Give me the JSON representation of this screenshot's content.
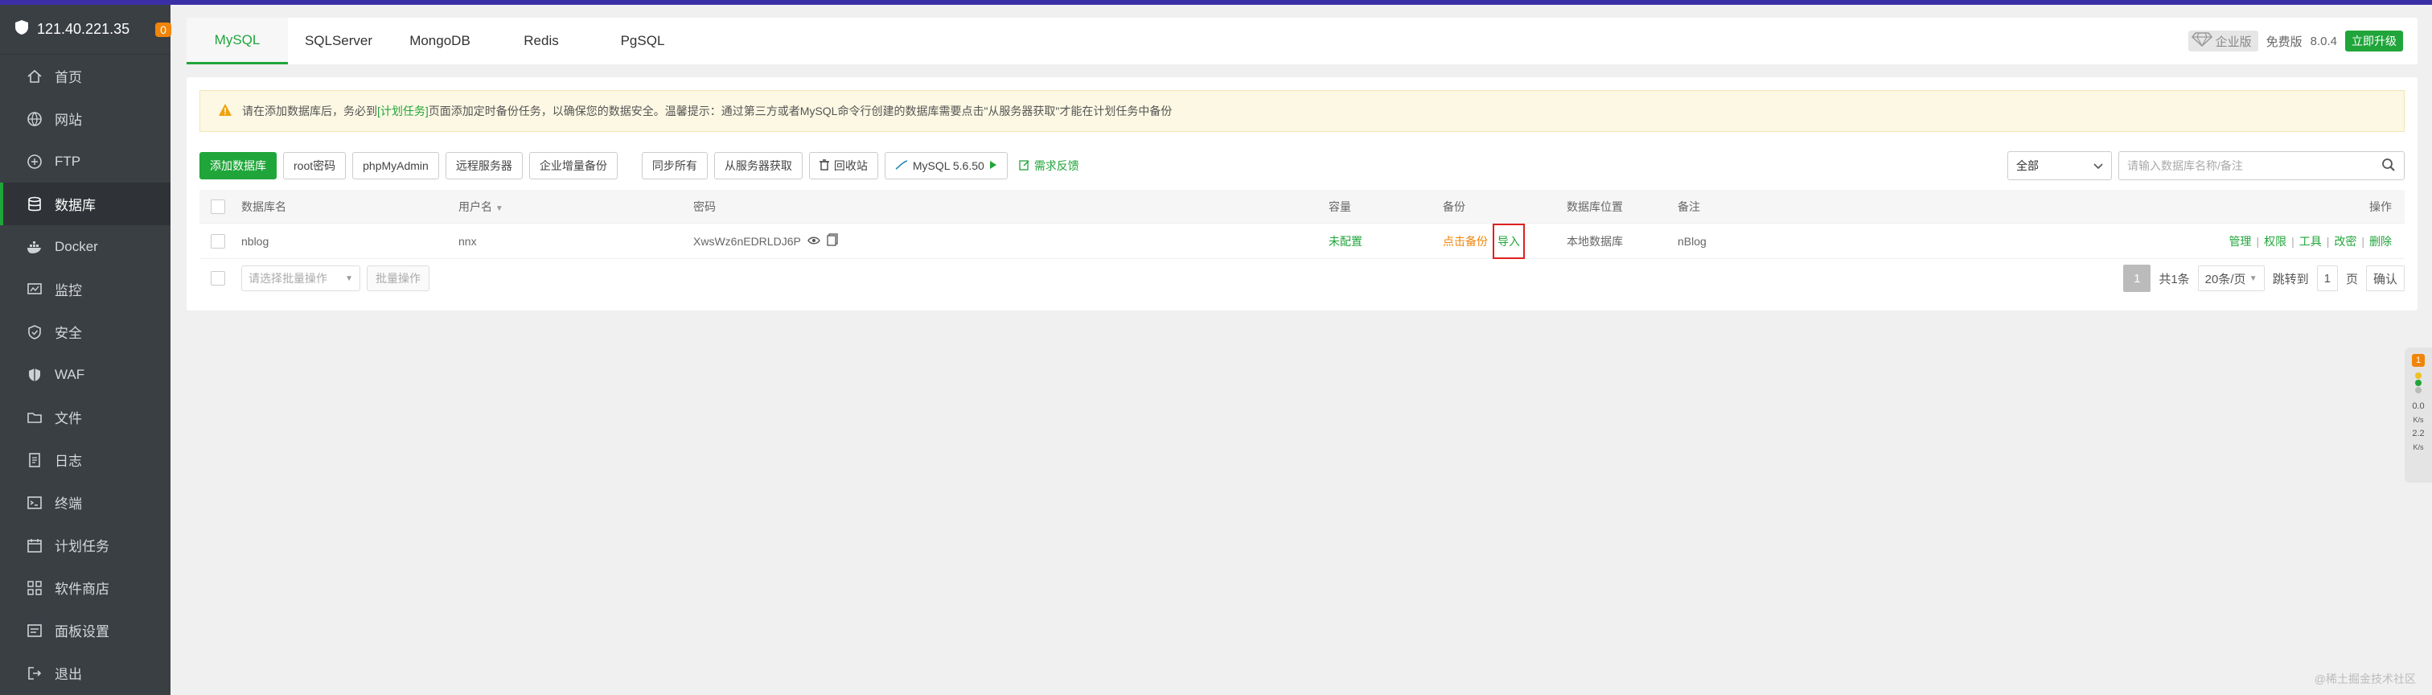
{
  "sidebar": {
    "ip": "121.40.221.35",
    "badge": "0",
    "items": [
      {
        "label": "首页",
        "icon": "home-icon"
      },
      {
        "label": "网站",
        "icon": "globe-icon"
      },
      {
        "label": "FTP",
        "icon": "ftp-icon"
      },
      {
        "label": "数据库",
        "icon": "database-icon"
      },
      {
        "label": "Docker",
        "icon": "docker-icon"
      },
      {
        "label": "监控",
        "icon": "monitor-icon"
      },
      {
        "label": "安全",
        "icon": "shield-icon"
      },
      {
        "label": "WAF",
        "icon": "waf-icon"
      },
      {
        "label": "文件",
        "icon": "folder-icon"
      },
      {
        "label": "日志",
        "icon": "log-icon"
      },
      {
        "label": "终端",
        "icon": "terminal-icon"
      },
      {
        "label": "计划任务",
        "icon": "calendar-icon"
      },
      {
        "label": "软件商店",
        "icon": "apps-icon"
      },
      {
        "label": "面板设置",
        "icon": "settings-icon"
      },
      {
        "label": "退出",
        "icon": "logout-icon"
      }
    ],
    "active_index": 3
  },
  "tabs": [
    "MySQL",
    "SQLServer",
    "MongoDB",
    "Redis",
    "PgSQL"
  ],
  "header_right": {
    "enterprise": "企业版",
    "edition": "免费版",
    "version": "8.0.4",
    "upgrade": "立即升级"
  },
  "notice": {
    "part1": "请在添加数据库后，务必到",
    "link": "[计划任务]",
    "part2": "页面添加定时备份任务，以确保您的数据安全。温馨提示：通过第三方或者MySQL命令行创建的数据库需要点击\"从服务器获取\"才能在计划任务中备份"
  },
  "toolbar": {
    "add_db": "添加数据库",
    "root_pw": "root密码",
    "phpmyadmin": "phpMyAdmin",
    "remote": "远程服务器",
    "enterprise_backup": "企业增量备份",
    "sync_all": "同步所有",
    "fetch_server": "从服务器获取",
    "recycle": "回收站",
    "mysql_version": "MySQL 5.6.50",
    "feedback": "需求反馈",
    "filter_all": "全部",
    "search_placeholder": "请输入数据库名称/备注"
  },
  "table": {
    "headers": {
      "name": "数据库名",
      "user": "用户名",
      "password": "密码",
      "capacity": "容量",
      "backup": "备份",
      "location": "数据库位置",
      "note": "备注",
      "ops": "操作"
    },
    "rows": [
      {
        "name": "nblog",
        "user": "nnx",
        "password": "XwsWz6nEDRLDJ6P",
        "capacity": "未配置",
        "backup": "点击备份",
        "import": "导入",
        "location": "本地数据库",
        "note": "nBlog",
        "ops": [
          "管理",
          "权限",
          "工具",
          "改密",
          "删除"
        ]
      }
    ]
  },
  "footer": {
    "batch_placeholder": "请选择批量操作",
    "batch_btn": "批量操作",
    "current_page": "1",
    "total": "共1条",
    "per_page": "20条/页",
    "jump_label": "跳转到",
    "jump_value": "1",
    "page_unit": "页",
    "confirm": "确认"
  },
  "float_widget": {
    "badge": "1",
    "up": "0.0",
    "down": "2.2",
    "unit": "K/s"
  },
  "watermark": "@稀土掘金技术社区",
  "colors": {
    "accent": "#20a53a",
    "sidebar_bg": "#3a3f44",
    "warning": "#f0850a",
    "highlight_box": "#e02020"
  }
}
